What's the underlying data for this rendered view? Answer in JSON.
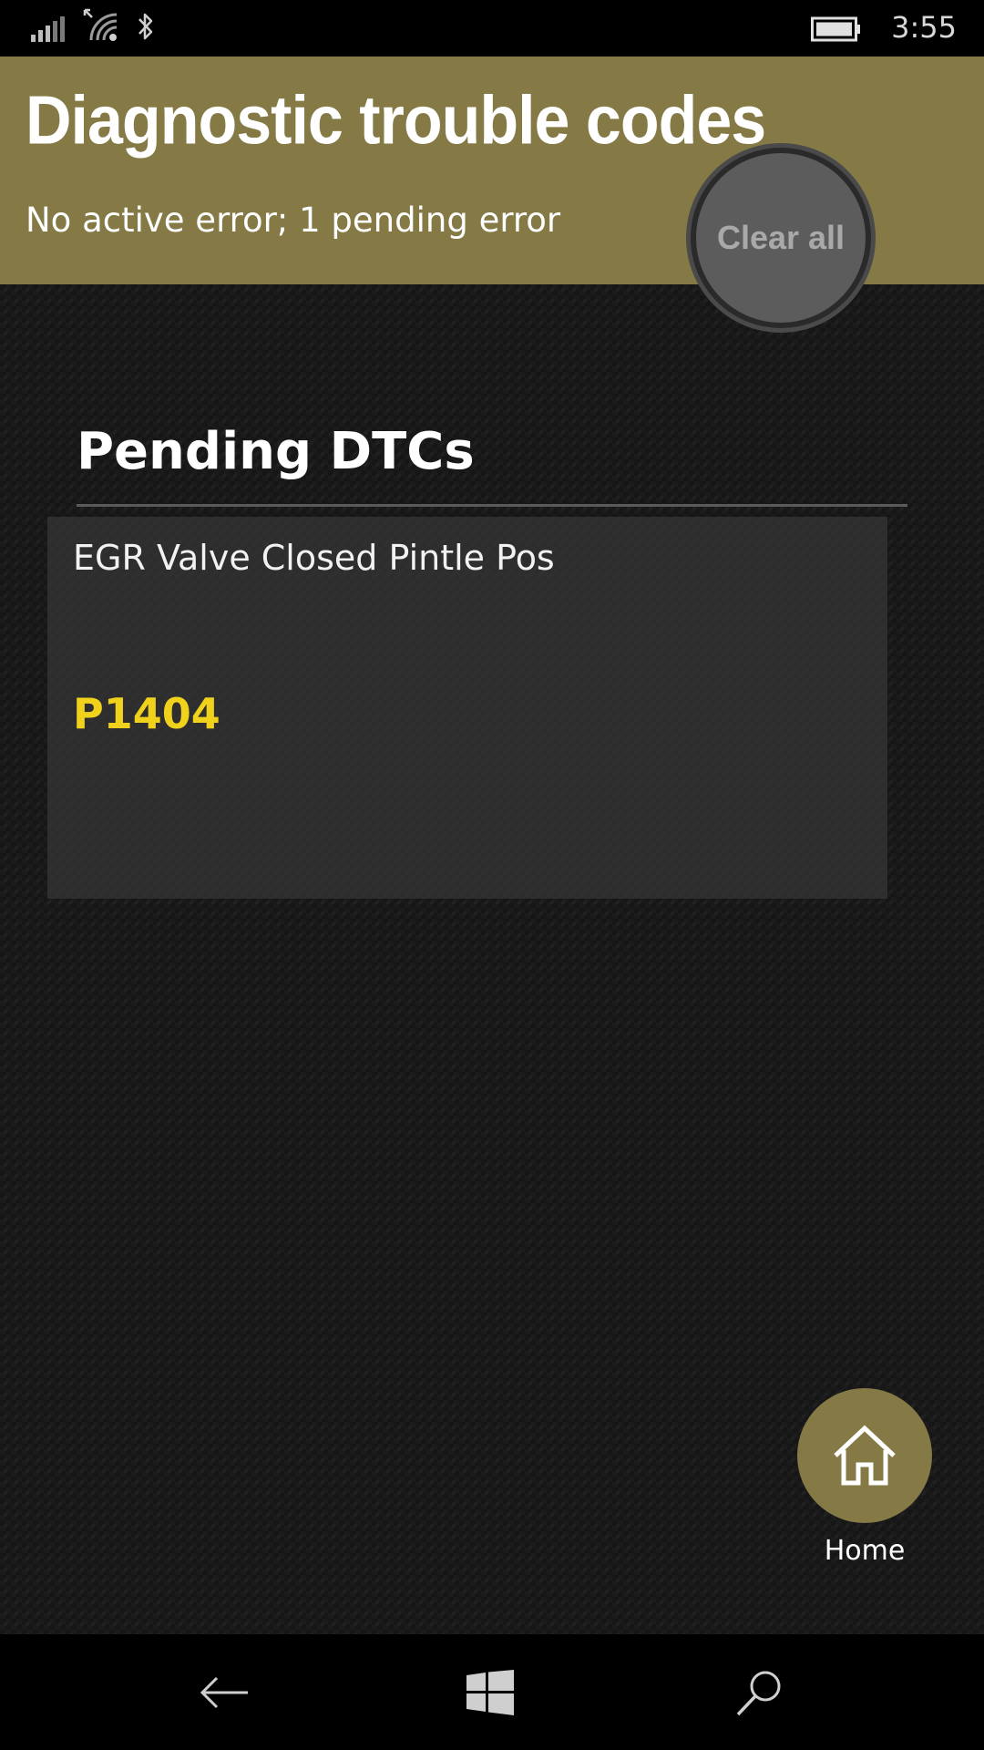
{
  "status_bar": {
    "time": "3:55"
  },
  "header": {
    "title": "Diagnostic trouble codes",
    "summary": "No active error; 1 pending error",
    "clear_all_label": "Clear all"
  },
  "section": {
    "title": "Pending DTCs"
  },
  "dtcs": [
    {
      "description": "EGR Valve Closed Pintle Pos",
      "code": "P1404"
    }
  ],
  "home_button": {
    "label": "Home"
  },
  "colors": {
    "header_bg": "#857a46",
    "code_color": "#f0d21c",
    "clear_button_bg": "#5c5c5c"
  },
  "icons": [
    "signal-icon",
    "wifi-icon",
    "bluetooth-icon",
    "battery-icon",
    "home-icon",
    "back-icon",
    "windows-start-icon",
    "search-icon"
  ]
}
